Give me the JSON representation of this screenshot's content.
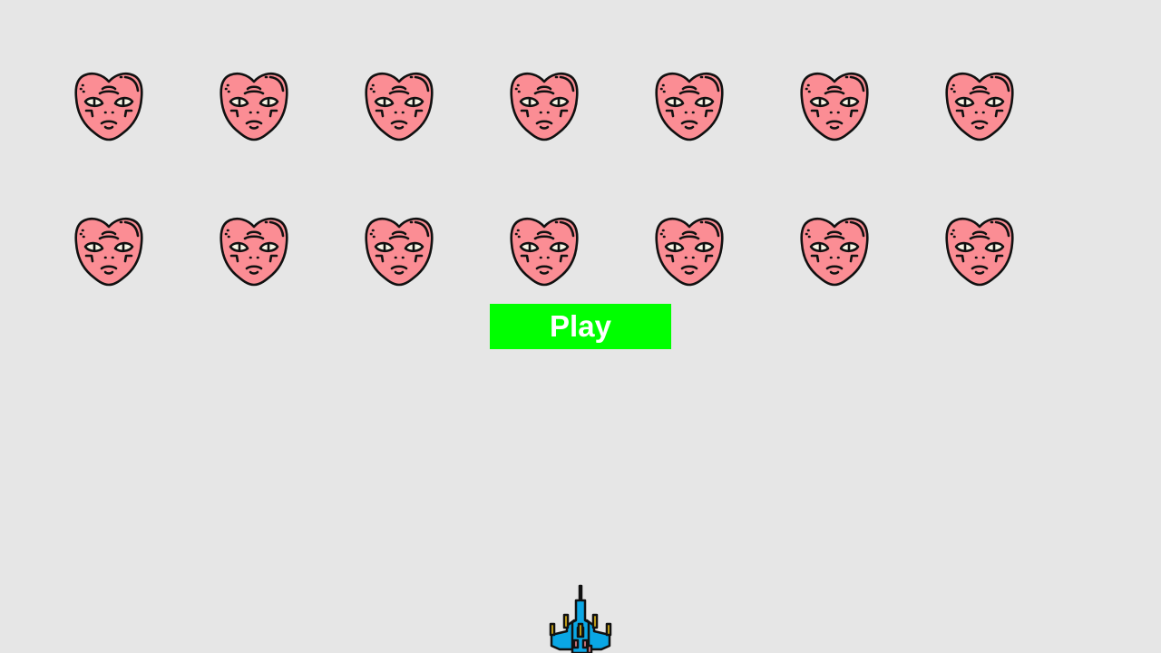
{
  "play_button": {
    "label": "Play",
    "color": "#00ff00"
  },
  "aliens": {
    "rows": 2,
    "columns": 7,
    "skin_color": "#fb8d94",
    "icon": "alien-head-icon"
  },
  "player": {
    "icon": "spaceship-icon",
    "hull_color": "#0aa7e5",
    "accent_color": "#f2c418"
  }
}
